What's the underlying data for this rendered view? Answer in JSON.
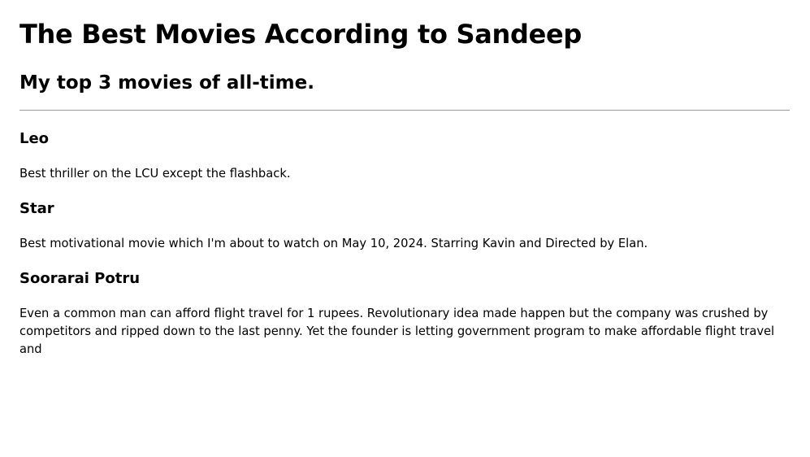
{
  "title": "The Best Movies According to Sandeep",
  "subtitle": "My top 3 movies of all-time.",
  "movies": [
    {
      "name": "Leo",
      "description": "Best thriller on the LCU except the flashback."
    },
    {
      "name": "Star",
      "description": "Best motivational movie which I'm about to watch on May 10, 2024. Starring Kavin and Directed by Elan."
    },
    {
      "name": "Soorarai Potru",
      "description": "Even a common man can afford flight travel for 1 rupees. Revolutionary idea made happen but the company was crushed by competitors and ripped down to the last penny. Yet the founder is letting government program to make affordable flight travel and"
    }
  ]
}
